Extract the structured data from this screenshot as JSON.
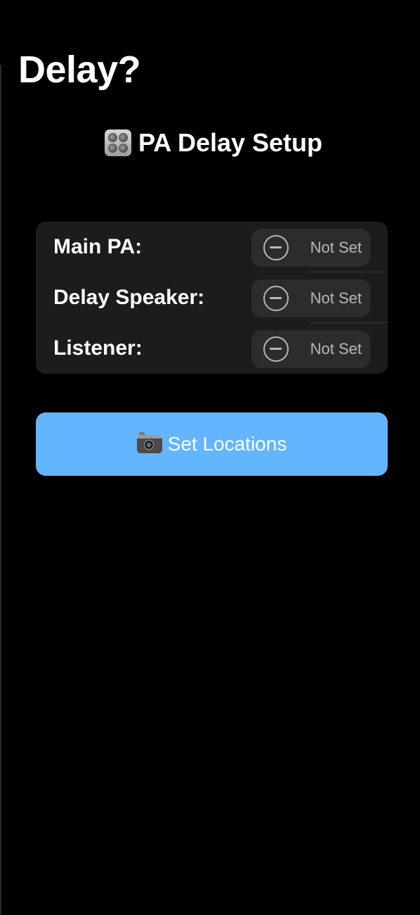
{
  "nav": {
    "title": "Delay?"
  },
  "section": {
    "icon": "control-knobs-icon",
    "heading": "PA Delay Setup"
  },
  "locations": [
    {
      "label": "Main PA:",
      "status": "Not Set",
      "status_icon": "minus-circle-icon"
    },
    {
      "label": "Delay Speaker:",
      "status": "Not Set",
      "status_icon": "minus-circle-icon"
    },
    {
      "label": "Listener:",
      "status": "Not Set",
      "status_icon": "minus-circle-icon"
    }
  ],
  "action": {
    "icon": "camera-icon",
    "label": "Set Locations"
  },
  "colors": {
    "background": "#000000",
    "card": "#1c1c1e",
    "pill": "#2c2c2e",
    "accent": "#64b5ff",
    "secondary_text": "#b8b8bb"
  }
}
